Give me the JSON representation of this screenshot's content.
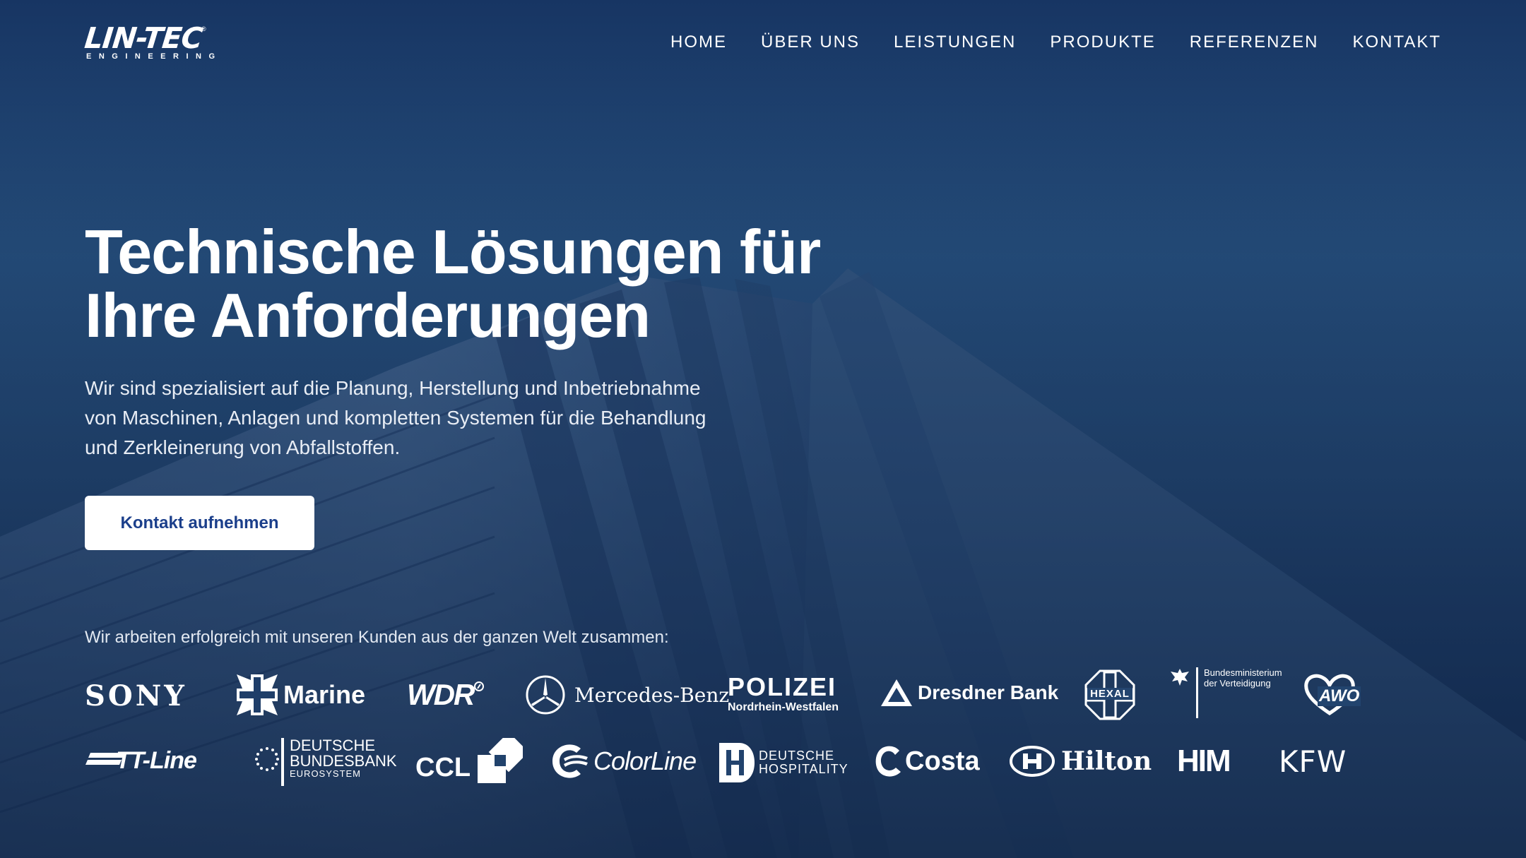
{
  "header": {
    "logo": {
      "name": "LIN-TEC",
      "subtitle": "ENGINEERING",
      "registered": "®"
    },
    "nav": [
      {
        "label": "HOME"
      },
      {
        "label": "ÜBER UNS"
      },
      {
        "label": "LEISTUNGEN"
      },
      {
        "label": "PRODUKTE"
      },
      {
        "label": "REFERENZEN"
      },
      {
        "label": "KONTAKT"
      }
    ]
  },
  "hero": {
    "headline_line1": "Technische Lösungen für",
    "headline_line2": "Ihre Anforderungen",
    "intro_line1": "Wir sind spezialisiert auf die Planung, Herstellung und Inbetriebnahme",
    "intro_line2": "von Maschinen, Anlagen und kompletten Systemen für die Behandlung",
    "intro_line3": "und Zerkleinerung von Abfallstoffen.",
    "cta_label": "Kontakt aufnehmen",
    "background": "skyscraper-photo"
  },
  "clients": {
    "label": "Wir arbeiten erfolgreich mit unseren Kunden aus der ganzen Welt zusammen:",
    "logos": {
      "sony": "SONY",
      "marine": "Marine",
      "wdr": "WDR",
      "mercedes": "Mercedes-Benz",
      "polizei": "POLIZEI",
      "polizei_sub": "Nordrhein-Westfalen",
      "dresdner": "Dresdner Bank",
      "hexal": "HEXAL",
      "bmvg_line1": "Bundesministerium",
      "bmvg_line2": "der Verteidigung",
      "awo": "AWO",
      "ttline": "TT-Line",
      "bundesbank_line1": "DEUTSCHE",
      "bundesbank_line2": "BUNDESBANK",
      "bundesbank_line3": "EUROSYSTEM",
      "ccl": "CCL",
      "colorline": "ColorLine",
      "dh_line1": "DEUTSCHE",
      "dh_line2": "HOSPITALITY",
      "costa": "Costa",
      "hilton": "Hilton",
      "him": "HIM",
      "kfw": "KFW"
    }
  },
  "colors": {
    "background_top": "#173563",
    "background_bottom": "#142a4c",
    "cta_text": "#1b3f8b",
    "cta_background": "#ffffff"
  }
}
